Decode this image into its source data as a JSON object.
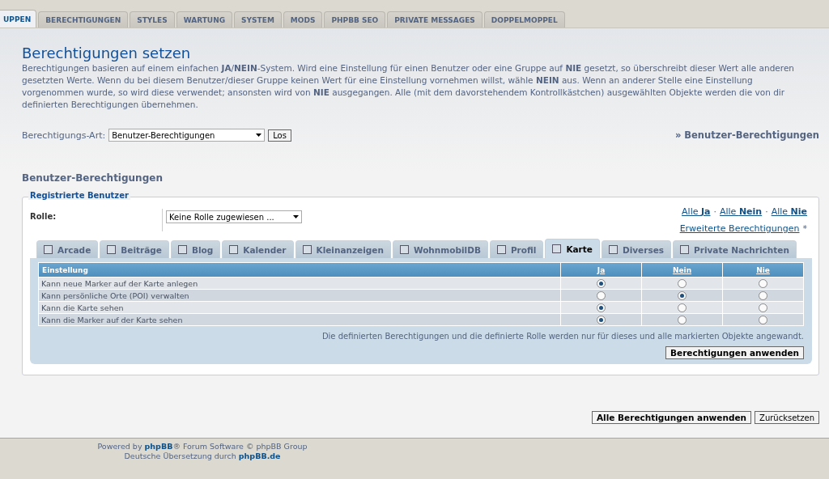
{
  "main_tabs": [
    {
      "label": "UPPEN",
      "selected": true
    },
    {
      "label": "BERECHTIGUNGEN",
      "selected": false
    },
    {
      "label": "STYLES",
      "selected": false
    },
    {
      "label": "WARTUNG",
      "selected": false
    },
    {
      "label": "SYSTEM",
      "selected": false
    },
    {
      "label": "MODS",
      "selected": false
    },
    {
      "label": "PHPBB SEO",
      "selected": false
    },
    {
      "label": "PRIVATE MESSAGES",
      "selected": false
    },
    {
      "label": "DOPPELMOPPEL",
      "selected": false
    }
  ],
  "title": "Berechtigungen setzen",
  "description": "Berechtigungen basieren auf einem einfachen **JA**/**NEIN**-System. Wird eine Einstellung für einen Benutzer oder eine Gruppe auf **NIE** gesetzt, so überschreibt dieser Wert alle anderen gesetzten Werte. Wenn du bei diesem Benutzer/dieser Gruppe keinen Wert für eine Einstellung vornehmen willst, wähle **NEIN** aus. Wenn an anderer Stelle eine Einstellung vorgenommen wurde, so wird diese verwendet; ansonsten wird von **NIE** ausgegangen. Alle (mit dem davorstehendem Kontrollkästchen) ausgewählten Objekte werden die von dir definierten Berechtigungen übernehmen.",
  "type_select": {
    "label": "Berechtigungs-Art:",
    "value": "Benutzer-Berechtigungen",
    "button": "Los",
    "link": "» Benutzer-Berechtigungen"
  },
  "section_title": "Benutzer-Berechtigungen",
  "fieldset": {
    "legend": "Registrierte Benutzer",
    "role_label": "Rolle:",
    "role_value": "Keine Rolle zugewiesen ...",
    "link_separator": "·",
    "all_links": [
      {
        "prefix": "Alle ",
        "word": "Ja"
      },
      {
        "prefix": "Alle ",
        "word": "Nein"
      },
      {
        "prefix": "Alle ",
        "word": "Nie"
      }
    ],
    "advanced_link": "Erweiterte Berechtigungen",
    "advanced_mark": "*",
    "tabs": [
      {
        "label": "Arcade",
        "selected": false
      },
      {
        "label": "Beiträge",
        "selected": false
      },
      {
        "label": "Blog",
        "selected": false
      },
      {
        "label": "Kalender",
        "selected": false
      },
      {
        "label": "Kleinanzeigen",
        "selected": false
      },
      {
        "label": "WohnmobilDB",
        "selected": false
      },
      {
        "label": "Profil",
        "selected": false
      },
      {
        "label": "Karte",
        "selected": true
      },
      {
        "label": "Diverses",
        "selected": false
      },
      {
        "label": "Private Nachrichten",
        "selected": false
      }
    ],
    "table": {
      "columns": [
        "Einstellung",
        "Ja",
        "Nein",
        "Nie"
      ],
      "rows": [
        {
          "label": "Kann neue Marker auf der Karte anlegen",
          "choices": [
            {
              "selected": true
            },
            {
              "selected": false
            },
            {
              "selected": false
            }
          ]
        },
        {
          "label": "Kann persönliche Orte (POI) verwalten",
          "choices": [
            {
              "selected": false
            },
            {
              "selected": true
            },
            {
              "selected": false
            }
          ]
        },
        {
          "label": "Kann die Karte sehen",
          "choices": [
            {
              "selected": true
            },
            {
              "selected": false
            },
            {
              "selected": false
            }
          ]
        },
        {
          "label": "Kann die Marker auf der Karte sehen",
          "choices": [
            {
              "selected": true
            },
            {
              "selected": false
            },
            {
              "selected": false
            }
          ]
        }
      ]
    },
    "note": "Die definierten Berechtigungen und die definierte Rolle werden nur für dieses und alle markierten Objekte angewandt.",
    "apply_button": "Berechtigungen anwenden"
  },
  "buttons": [
    "Alle Berechtigungen anwenden",
    "Zurücksetzen"
  ],
  "footer": [
    "Powered by **phpBB**® Forum Software © phpBB Group",
    "Deutsche Übersetzung durch **phpBB.de**"
  ]
}
